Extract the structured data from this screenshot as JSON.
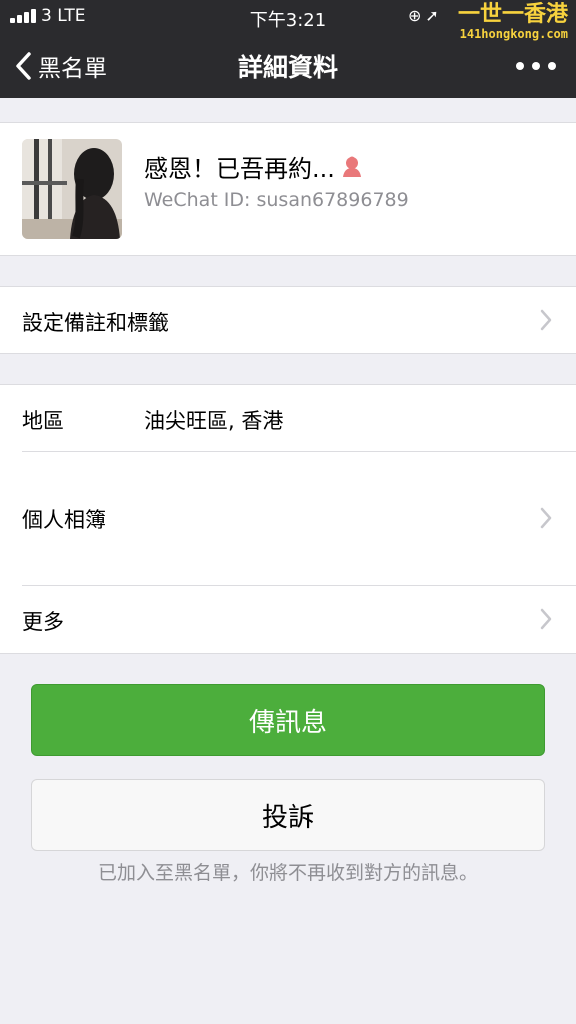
{
  "status_bar": {
    "carrier": "3 LTE",
    "time": "下午3:21",
    "icons": [
      "lock-rotation-icon",
      "location-arrow-icon",
      "alarm-icon",
      "battery-icon"
    ]
  },
  "watermark": {
    "logo": "一世一香港",
    "site": "141hongkong.com"
  },
  "nav": {
    "back_label": "黑名單",
    "title": "詳細資料",
    "more_icon": "ellipsis-icon"
  },
  "profile": {
    "name": "感恩！已吾再約...",
    "gender_icon": "female-icon",
    "wechat_id": "WeChat ID: susan67896789"
  },
  "rows": {
    "remark": "設定備註和標籤",
    "region_label": "地區",
    "region_value": "油尖旺區, 香港",
    "album": "個人相簿",
    "more": "更多"
  },
  "actions": {
    "message": "傳訊息",
    "report": "投訴"
  },
  "blacklist_note": "已加入至黑名單，你將不再收到對方的訊息。",
  "colors": {
    "nav_bg": "#2b2b2e",
    "primary_green": "#4cae3c",
    "page_bg": "#efeff4",
    "female_icon": "#e9787a",
    "watermark_yellow": "#f7d23e"
  }
}
